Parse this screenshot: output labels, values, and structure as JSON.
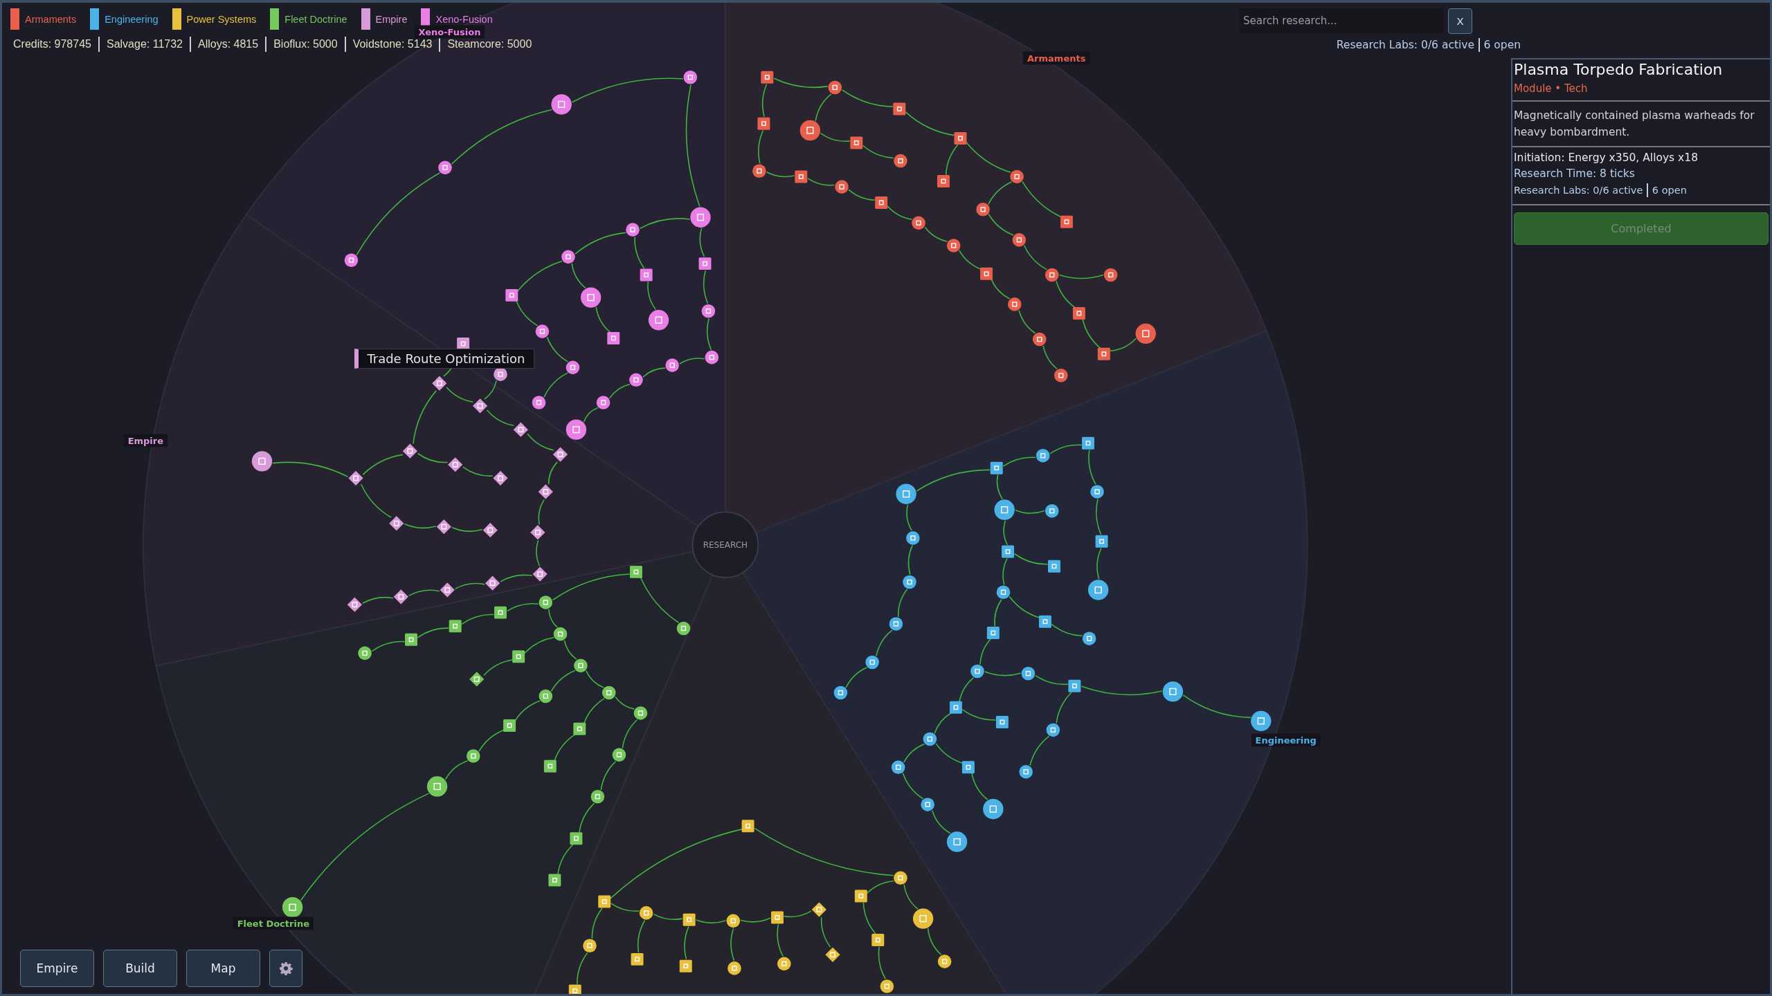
{
  "legend": [
    {
      "label": "Armaments",
      "color": "#e8604c"
    },
    {
      "label": "Engineering",
      "color": "#4cb3e8"
    },
    {
      "label": "Power Systems",
      "color": "#e8c03c"
    },
    {
      "label": "Fleet Doctrine",
      "color": "#74c85c"
    },
    {
      "label": "Empire",
      "color": "#d89ad8"
    },
    {
      "label": "Xeno-Fusion",
      "color": "#e87ee6"
    }
  ],
  "resources": [
    "Credits: 978745",
    "Salvage: 11732",
    "Alloys: 4815",
    "Bioflux: 5000",
    "Voidstone: 5143",
    "Steamcore: 5000"
  ],
  "search": {
    "placeholder": "Search research...",
    "clear_button": "X"
  },
  "labs_status": {
    "active": "Research Labs: 0/6 active",
    "open": "6 open"
  },
  "tree": {
    "hub_label": "RESEARCH",
    "sectors": [
      {
        "label": "Armaments",
        "color": "#e8604c"
      },
      {
        "label": "Engineering",
        "color": "#4cb3e8"
      },
      {
        "color": "#e8c03c"
      },
      {
        "label": "Fleet Doctrine",
        "color": "#74c85c"
      },
      {
        "label": "Empire",
        "color": "#d89ad8"
      },
      {
        "label": "Xeno-Fusion",
        "color": "#e87ee6"
      }
    ],
    "tooltip": "Trade Route Optimization"
  },
  "details": {
    "title": "Plasma Torpedo Fabrication",
    "subtitle": "Module • Tech",
    "description": "Magnetically contained plasma warheads for heavy bombardment.",
    "initiation": "Initiation: Energy x350, Alloys x18",
    "research_time": "Research Time: 8 ticks",
    "labs_active": "Research Labs: 0/6 active",
    "labs_open": "6 open",
    "action": {
      "label": "Completed",
      "disabled": true
    }
  },
  "bottom_buttons": [
    "Empire",
    "Build",
    "Map"
  ]
}
